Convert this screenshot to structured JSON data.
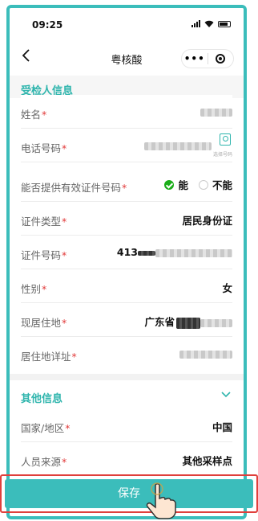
{
  "status_bar": {
    "time": "09:25"
  },
  "nav": {
    "title": "粤核酸",
    "more_label": "•••"
  },
  "section1": {
    "title": "受检人信息",
    "rows": [
      {
        "label": "姓名",
        "required": "*"
      },
      {
        "label": "电话号码",
        "required": "*",
        "icon_caption": "选择号码"
      },
      {
        "label": "能否提供有效证件号码",
        "required": "*",
        "option_yes": "能",
        "option_no": "不能",
        "selected": "能"
      },
      {
        "label": "证件类型",
        "required": "*",
        "value": "居民身份证"
      },
      {
        "label": "证件号码",
        "required": "*",
        "value_prefix": "413"
      },
      {
        "label": "性别",
        "required": "*",
        "value": "女"
      },
      {
        "label": "现居住地",
        "required": "*",
        "value_prefix": "广东省"
      },
      {
        "label": "居住地详址",
        "required": "*"
      }
    ]
  },
  "section2": {
    "title": "其他信息",
    "rows": [
      {
        "label": "国家/地区",
        "required": "*",
        "value": "中国"
      },
      {
        "label": "人员来源",
        "required": "*",
        "value": "其他采样点"
      }
    ]
  },
  "footer": {
    "save_label": "保存"
  },
  "colors": {
    "accent": "#3bbdbb",
    "title_teal": "#2fb5ad",
    "required": "#e23b3b",
    "highlight_box": "#e0403c",
    "radio_checked": "#1aad19"
  },
  "icons": [
    "back-arrow-icon",
    "more-icon",
    "close-target-icon",
    "contact-card-icon",
    "chevron-down-icon",
    "pointing-hand-icon"
  ]
}
